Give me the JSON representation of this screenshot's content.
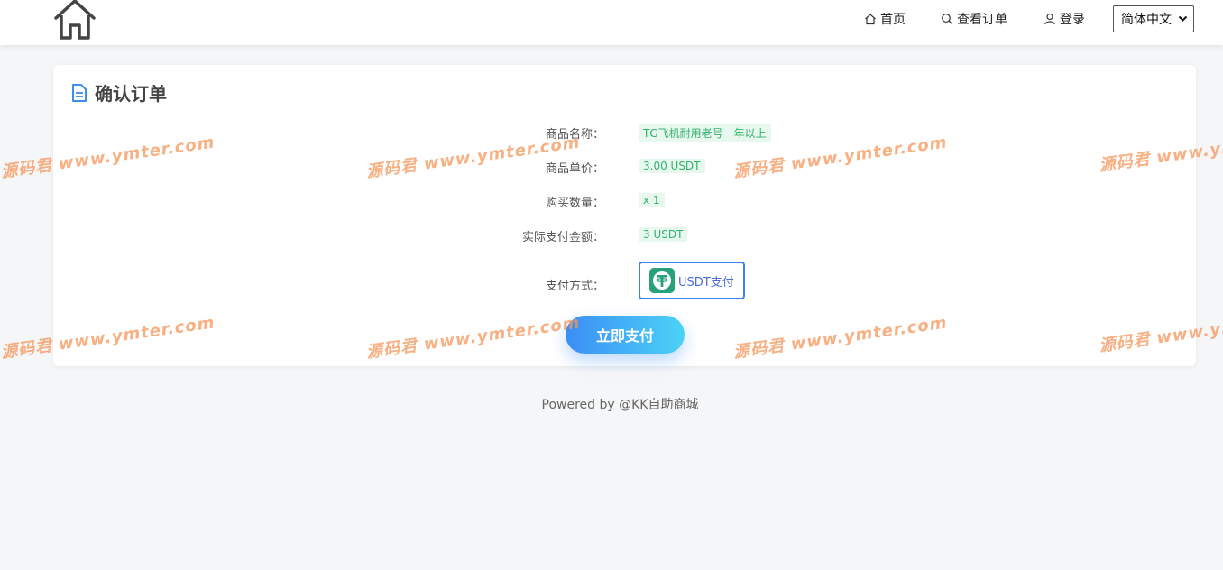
{
  "header": {
    "logo_icon": "home-outline-icon",
    "nav": {
      "home": "首页",
      "orders": "查看订单",
      "login": "登录"
    },
    "language": "简体中文"
  },
  "card": {
    "title": "确认订单",
    "fields": [
      {
        "label": "商品名称：",
        "value": "TG飞机耐用老号一年以上"
      },
      {
        "label": "商品单价：",
        "value": "3.00 USDT"
      },
      {
        "label": "购买数量：",
        "value": "x 1"
      },
      {
        "label": "实际支付金额：",
        "value": "3 USDT"
      }
    ],
    "payment_method_label": "支付方式：",
    "payment_option": "USDT支付",
    "submit_label": "立即支付"
  },
  "footer": {
    "text": "Powered by @KK自助商城"
  },
  "watermark": {
    "text": "源码君  www.ymter.com"
  },
  "colors": {
    "accent": "#3d82f5",
    "tag_bg": "#e7f8ee",
    "tag_text": "#33b26b",
    "usdt_green": "#26a17b"
  }
}
